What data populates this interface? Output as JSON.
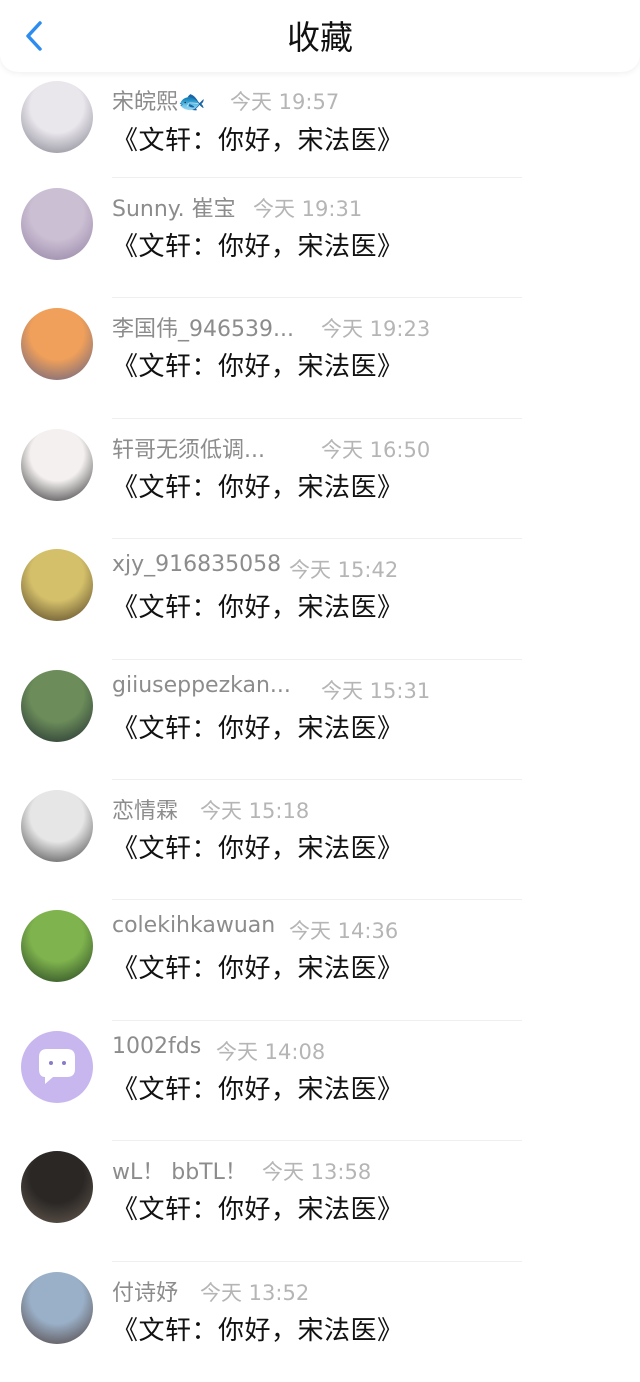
{
  "header": {
    "title": "收藏"
  },
  "items": [
    {
      "nick": "宋皖熙🐟",
      "time": "今天 19:57",
      "msg": "《文轩：你好，宋法医》",
      "avatar_colors": [
        "#e9e6ec",
        "#7b7a86"
      ]
    },
    {
      "nick": "Sunny. 崔宝",
      "time": "今天 19:31",
      "msg": "《文轩：你好，宋法医》",
      "avatar_colors": [
        "#cbbfd3",
        "#8f7ea1"
      ]
    },
    {
      "nick": "李国伟_946539...",
      "time": "今天 19:23",
      "msg": "《文轩：你好，宋法医》",
      "avatar_colors": [
        "#f0a05a",
        "#5b5d86"
      ]
    },
    {
      "nick": "轩哥无须低调...",
      "time": "今天 16:50",
      "msg": "《文轩：你好，宋法医》",
      "avatar_colors": [
        "#f4f0f0",
        "#222222"
      ]
    },
    {
      "nick": "xjy_916835058",
      "time": "今天 15:42",
      "msg": "《文轩：你好，宋法医》",
      "avatar_colors": [
        "#d4c06a",
        "#4b3a22"
      ]
    },
    {
      "nick": "giiuseppezkan...",
      "time": "今天 15:31",
      "msg": "《文轩：你好，宋法医》",
      "avatar_colors": [
        "#6c8d5a",
        "#1d2a2e"
      ]
    },
    {
      "nick": "恋情霖",
      "time": "今天 15:18",
      "msg": "《文轩：你好，宋法医》",
      "avatar_colors": [
        "#e6e6e6",
        "#3b3b3b"
      ]
    },
    {
      "nick": "colekihkawuan",
      "time": "今天 14:36",
      "msg": "《文轩：你好，宋法医》",
      "avatar_colors": [
        "#7fb34d",
        "#1f3a20"
      ]
    },
    {
      "nick": "1002fds",
      "time": "今天 14:08",
      "msg": "《文轩：你好，宋法医》",
      "avatar_colors": [
        "#c8b6ef",
        "#ffffff"
      ]
    },
    {
      "nick": "wL！ bbTL！",
      "time": "今天 13:58",
      "msg": "《文轩：你好，宋法医》",
      "avatar_colors": [
        "#2a2725",
        "#6a5e52"
      ]
    },
    {
      "nick": "付诗妤",
      "time": "今天 13:52",
      "msg": "《文轩：你好，宋法医》",
      "avatar_colors": [
        "#9ab0c8",
        "#4a3a36"
      ]
    }
  ],
  "colors": {
    "accent": "#2d8cf0",
    "nick": "#8c8c8c",
    "time": "#b5b5b5",
    "text": "#111111"
  }
}
